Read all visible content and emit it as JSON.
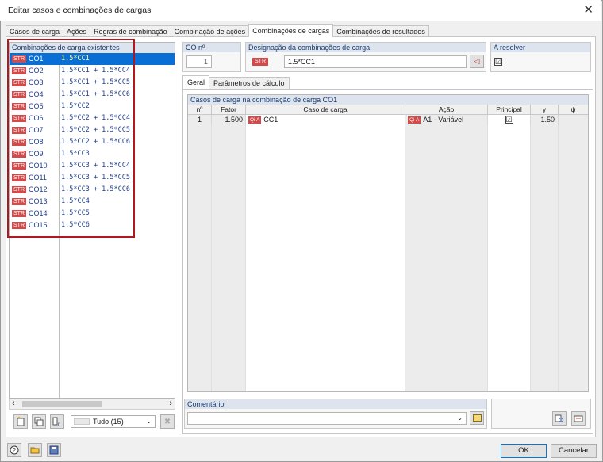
{
  "window": {
    "title": "Editar casos e combinações de cargas"
  },
  "tabs": [
    {
      "label": "Casos de carga"
    },
    {
      "label": "Ações"
    },
    {
      "label": "Regras de combinação"
    },
    {
      "label": "Combinação de ações"
    },
    {
      "label": "Combinações de cargas"
    },
    {
      "label": "Combinações de resultados"
    }
  ],
  "left_list": {
    "header": "Combinações de carga existentes",
    "tag": "STR",
    "items": [
      {
        "id": "CO1",
        "desc": "1.5*CC1"
      },
      {
        "id": "CO2",
        "desc": "1.5*CC1 + 1.5*CC4"
      },
      {
        "id": "CO3",
        "desc": "1.5*CC1 + 1.5*CC5"
      },
      {
        "id": "CO4",
        "desc": "1.5*CC1 + 1.5*CC6"
      },
      {
        "id": "CO5",
        "desc": "1.5*CC2"
      },
      {
        "id": "CO6",
        "desc": "1.5*CC2 + 1.5*CC4"
      },
      {
        "id": "CO7",
        "desc": "1.5*CC2 + 1.5*CC5"
      },
      {
        "id": "CO8",
        "desc": "1.5*CC2 + 1.5*CC6"
      },
      {
        "id": "CO9",
        "desc": "1.5*CC3"
      },
      {
        "id": "CO10",
        "desc": "1.5*CC3 + 1.5*CC4"
      },
      {
        "id": "CO11",
        "desc": "1.5*CC3 + 1.5*CC5"
      },
      {
        "id": "CO12",
        "desc": "1.5*CC3 + 1.5*CC6"
      },
      {
        "id": "CO13",
        "desc": "1.5*CC4"
      },
      {
        "id": "CO14",
        "desc": "1.5*CC5"
      },
      {
        "id": "CO15",
        "desc": "1.5*CC6"
      }
    ],
    "filter_value": "Tudo (15)"
  },
  "co_no": {
    "label": "CO nº",
    "value": "1"
  },
  "designation": {
    "label": "Designação da combinações de carga",
    "tag": "STR",
    "value": "1.5*CC1"
  },
  "resolve": {
    "label": "A resolver",
    "checked": "☑"
  },
  "subtabs": [
    {
      "label": "Geral"
    },
    {
      "label": "Parâmetros de cálculo"
    }
  ],
  "grid": {
    "title": "Casos de carga na combinação de carga CO1",
    "headers": {
      "no": "nº",
      "factor": "Fator",
      "case": "Caso de carga",
      "action": "Ação",
      "principal": "Principal",
      "gamma": "γ",
      "psi": "ψ"
    },
    "rows": [
      {
        "no": "1",
        "factor": "1.500",
        "case_tag": "Qi A",
        "case": "CC1",
        "action_tag": "Qi A",
        "action": "A1 - Variável",
        "principal": "☑",
        "gamma": "1.50",
        "psi": ""
      }
    ]
  },
  "comment": {
    "label": "Comentário",
    "value": ""
  },
  "footer": {
    "ok": "OK",
    "cancel": "Cancelar"
  },
  "icons": [
    "close-icon",
    "new-icon",
    "copy-icon",
    "renumber-icon",
    "delete-icon",
    "help-icon",
    "open-icon",
    "save-icon"
  ]
}
